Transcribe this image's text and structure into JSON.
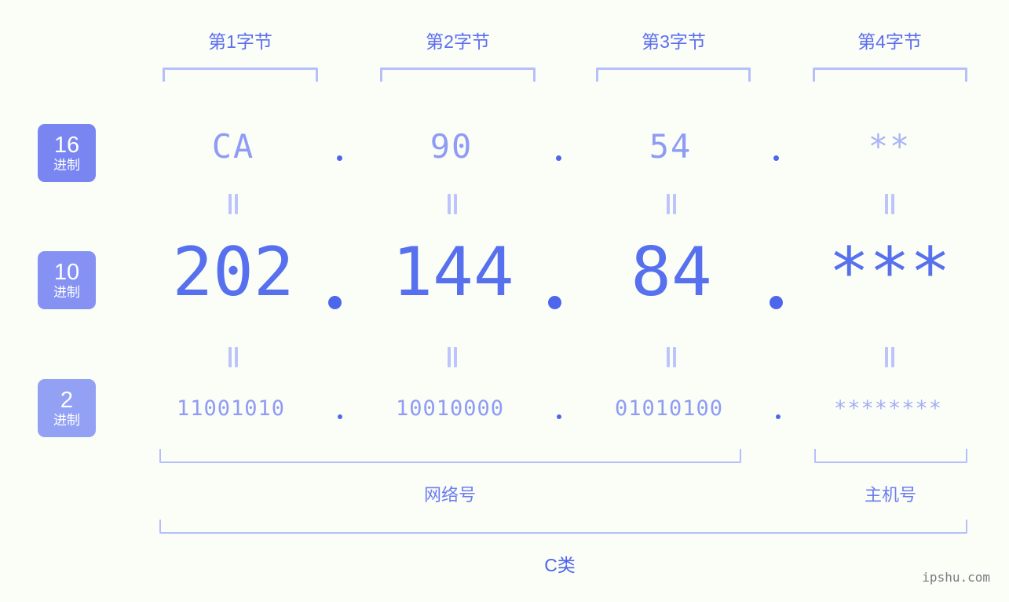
{
  "background_color": "#fbfdf7",
  "accent_colors": {
    "badge_dark": "#7986f2",
    "badge_mid": "#8592f3",
    "badge_light": "#93a1f5",
    "bracket": "#b7bffb",
    "hex_text": "#8e9cf3",
    "dec_text": "#5670ee",
    "bin_text": "#8e9cf3",
    "dot": "#4d67ec",
    "label_text": "#5b6ef0",
    "watermark": "#7b7b83"
  },
  "byte_headers": [
    {
      "label": "第1字节"
    },
    {
      "label": "第2字节"
    },
    {
      "label": "第3字节"
    },
    {
      "label": "第4字节"
    }
  ],
  "bases": [
    {
      "num": "16",
      "unit": "进制",
      "name": "hexadecimal"
    },
    {
      "num": "10",
      "unit": "进制",
      "name": "decimal"
    },
    {
      "num": "2",
      "unit": "进制",
      "name": "binary"
    }
  ],
  "rows": {
    "hex": {
      "base_label": "16进制",
      "values": [
        "CA",
        "90",
        "54",
        "**"
      ],
      "separator": "."
    },
    "decimal": {
      "base_label": "10进制",
      "values": [
        "202",
        "144",
        "84",
        "***"
      ],
      "separator": "."
    },
    "binary": {
      "base_label": "2进制",
      "values": [
        "11001010",
        "10010000",
        "01010100",
        "********"
      ],
      "separator": "."
    }
  },
  "equals_symbol": "=",
  "sections": [
    {
      "label": "网络号",
      "name": "network-number"
    },
    {
      "label": "主机号",
      "name": "host-number"
    }
  ],
  "ip_class": {
    "label": "C类"
  },
  "watermark": {
    "text": "ipshu.com"
  }
}
